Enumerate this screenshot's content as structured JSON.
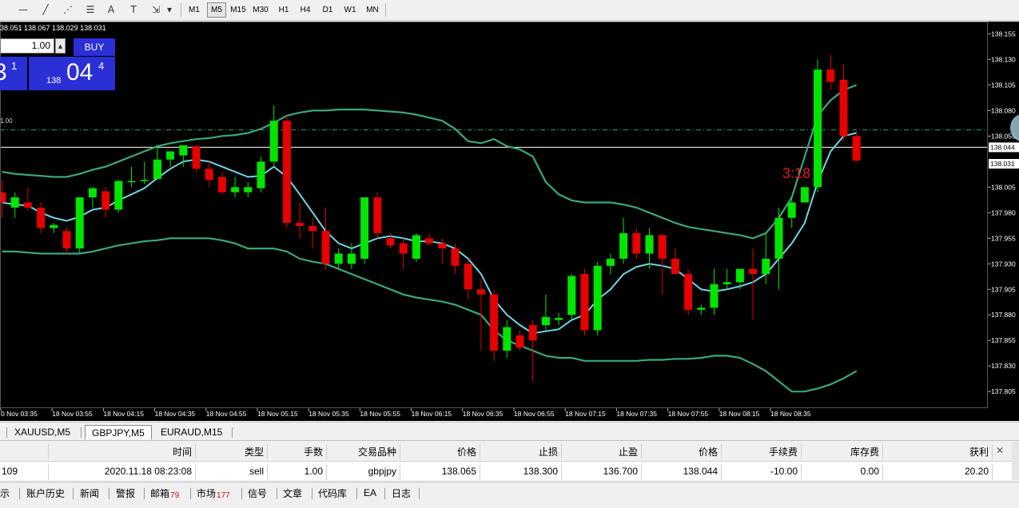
{
  "toolbar": {
    "drawing_tools": [
      {
        "name": "horizontal-line-icon",
        "glyph": "—"
      },
      {
        "name": "trendline-icon",
        "glyph": "╱"
      },
      {
        "name": "fibonacci-fan-icon",
        "glyph": "⋰"
      },
      {
        "name": "fibonacci-retracement-icon",
        "glyph": "☰"
      },
      {
        "name": "text-icon",
        "glyph": "A"
      },
      {
        "name": "text-label-icon",
        "glyph": "T"
      },
      {
        "name": "arrows-icon",
        "glyph": "⇲"
      },
      {
        "name": "chevron-down-icon",
        "glyph": "▾"
      }
    ],
    "timeframes": [
      "M1",
      "M5",
      "M15",
      "M30",
      "H1",
      "H4",
      "D1",
      "W1",
      "MN"
    ],
    "active_timeframe": "M5"
  },
  "chart": {
    "ohlc_text": "38.051 138.067 138.029 138.031",
    "lot_value": "1.00",
    "buy_label": "BUY",
    "sell_price_big": "3",
    "sell_price_sup": "1",
    "buy_price_prefix": "138",
    "buy_price_big": "04",
    "buy_price_sup": "4",
    "lot_line_label": "1.00",
    "countdown": "3:18",
    "price_labels": [
      "138.155",
      "138.130",
      "138.105",
      "138.080",
      "138.055",
      "138.005",
      "137.980",
      "137.955",
      "137.930",
      "137.905",
      "137.880",
      "137.855",
      "137.830",
      "137.805"
    ],
    "current_price_label": "138.044",
    "bid_price_label": "138.031",
    "time_labels": [
      "0 Nov 03:35",
      "18 Nov 03:55",
      "18 Nov 04:15",
      "18 Nov 04:35",
      "18 Nov 04:55",
      "18 Nov 05:15",
      "18 Nov 05:35",
      "18 Nov 05:55",
      "18 Nov 06:15",
      "18 Nov 06:35",
      "18 Nov 06:55",
      "18 Nov 07:15",
      "18 Nov 07:35",
      "18 Nov 07:55",
      "18 Nov 08:15",
      "18 Nov 08:35"
    ],
    "colors": {
      "bull": "#00e600",
      "bear": "#e60000",
      "bands": "#3aa87a",
      "ma": "#6fd7e6",
      "price_line": "#ffffff",
      "lot_line": "#2e9e6e"
    }
  },
  "chart_data": {
    "type": "candlestick",
    "symbol": "GBPJPY",
    "timeframe": "M5",
    "ylim": [
      137.795,
      138.16
    ],
    "current_price": 138.044,
    "lot_line_price": 138.061,
    "candles": [
      {
        "o": 138.0,
        "h": 138.012,
        "l": 137.975,
        "c": 137.99
      },
      {
        "o": 137.985,
        "h": 138.0,
        "l": 137.975,
        "c": 137.995
      },
      {
        "o": 137.99,
        "h": 138.005,
        "l": 137.982,
        "c": 137.985
      },
      {
        "o": 137.985,
        "h": 137.99,
        "l": 137.96,
        "c": 137.965
      },
      {
        "o": 137.965,
        "h": 137.97,
        "l": 137.96,
        "c": 137.968
      },
      {
        "o": 137.962,
        "h": 137.966,
        "l": 137.94,
        "c": 137.945
      },
      {
        "o": 137.945,
        "h": 137.995,
        "l": 137.94,
        "c": 137.995
      },
      {
        "o": 137.995,
        "h": 138.005,
        "l": 137.985,
        "c": 138.004
      },
      {
        "o": 138.001,
        "h": 138.005,
        "l": 137.975,
        "c": 137.983
      },
      {
        "o": 137.983,
        "h": 138.012,
        "l": 137.98,
        "c": 138.011
      },
      {
        "o": 138.011,
        "h": 138.025,
        "l": 138.005,
        "c": 138.011
      },
      {
        "o": 138.012,
        "h": 138.03,
        "l": 138.008,
        "c": 138.012
      },
      {
        "o": 138.013,
        "h": 138.046,
        "l": 138.012,
        "c": 138.032
      },
      {
        "o": 138.032,
        "h": 138.04,
        "l": 138.025,
        "c": 138.04
      },
      {
        "o": 138.036,
        "h": 138.045,
        "l": 138.025,
        "c": 138.046
      },
      {
        "o": 138.045,
        "h": 138.046,
        "l": 138.02,
        "c": 138.023
      },
      {
        "o": 138.023,
        "h": 138.03,
        "l": 138.005,
        "c": 138.012
      },
      {
        "o": 138.015,
        "h": 138.02,
        "l": 137.998,
        "c": 138.0
      },
      {
        "o": 138.0,
        "h": 138.015,
        "l": 137.995,
        "c": 138.005
      },
      {
        "o": 138.0,
        "h": 138.01,
        "l": 137.995,
        "c": 138.005
      },
      {
        "o": 138.004,
        "h": 138.035,
        "l": 138.0,
        "c": 138.03
      },
      {
        "o": 138.03,
        "h": 138.085,
        "l": 138.025,
        "c": 138.07
      },
      {
        "o": 138.07,
        "h": 138.075,
        "l": 137.965,
        "c": 137.97
      },
      {
        "o": 137.97,
        "h": 137.99,
        "l": 137.955,
        "c": 137.967
      },
      {
        "o": 137.967,
        "h": 137.975,
        "l": 137.945,
        "c": 137.962
      },
      {
        "o": 137.962,
        "h": 137.985,
        "l": 137.925,
        "c": 137.93
      },
      {
        "o": 137.93,
        "h": 137.945,
        "l": 137.925,
        "c": 137.94
      },
      {
        "o": 137.93,
        "h": 137.95,
        "l": 137.925,
        "c": 137.94
      },
      {
        "o": 137.935,
        "h": 137.995,
        "l": 137.93,
        "c": 137.995
      },
      {
        "o": 137.995,
        "h": 138.0,
        "l": 137.955,
        "c": 137.96
      },
      {
        "o": 137.955,
        "h": 137.96,
        "l": 137.945,
        "c": 137.948
      },
      {
        "o": 137.95,
        "h": 137.955,
        "l": 137.925,
        "c": 137.94
      },
      {
        "o": 137.935,
        "h": 137.96,
        "l": 137.932,
        "c": 137.958
      },
      {
        "o": 137.955,
        "h": 137.96,
        "l": 137.948,
        "c": 137.95
      },
      {
        "o": 137.95,
        "h": 137.955,
        "l": 137.93,
        "c": 137.945
      },
      {
        "o": 137.945,
        "h": 137.95,
        "l": 137.92,
        "c": 137.928
      },
      {
        "o": 137.93,
        "h": 137.935,
        "l": 137.895,
        "c": 137.905
      },
      {
        "o": 137.905,
        "h": 137.915,
        "l": 137.845,
        "c": 137.9
      },
      {
        "o": 137.9,
        "h": 137.905,
        "l": 137.835,
        "c": 137.845
      },
      {
        "o": 137.845,
        "h": 137.875,
        "l": 137.838,
        "c": 137.868
      },
      {
        "o": 137.86,
        "h": 137.865,
        "l": 137.845,
        "c": 137.848
      },
      {
        "o": 137.87,
        "h": 137.875,
        "l": 137.815,
        "c": 137.855
      },
      {
        "o": 137.87,
        "h": 137.9,
        "l": 137.865,
        "c": 137.878
      },
      {
        "o": 137.875,
        "h": 137.882,
        "l": 137.87,
        "c": 137.877
      },
      {
        "o": 137.88,
        "h": 137.92,
        "l": 137.875,
        "c": 137.918
      },
      {
        "o": 137.92,
        "h": 137.925,
        "l": 137.86,
        "c": 137.865
      },
      {
        "o": 137.865,
        "h": 137.932,
        "l": 137.86,
        "c": 137.928
      },
      {
        "o": 137.928,
        "h": 137.94,
        "l": 137.92,
        "c": 137.935
      },
      {
        "o": 137.935,
        "h": 137.975,
        "l": 137.93,
        "c": 137.96
      },
      {
        "o": 137.96,
        "h": 137.965,
        "l": 137.935,
        "c": 137.94
      },
      {
        "o": 137.94,
        "h": 137.965,
        "l": 137.925,
        "c": 137.958
      },
      {
        "o": 137.958,
        "h": 137.96,
        "l": 137.9,
        "c": 137.935
      },
      {
        "o": 137.935,
        "h": 137.945,
        "l": 137.92,
        "c": 137.92
      },
      {
        "o": 137.92,
        "h": 137.925,
        "l": 137.88,
        "c": 137.885
      },
      {
        "o": 137.885,
        "h": 137.89,
        "l": 137.88,
        "c": 137.887
      },
      {
        "o": 137.887,
        "h": 137.925,
        "l": 137.88,
        "c": 137.91
      },
      {
        "o": 137.91,
        "h": 137.925,
        "l": 137.905,
        "c": 137.912
      },
      {
        "o": 137.912,
        "h": 137.925,
        "l": 137.905,
        "c": 137.925
      },
      {
        "o": 137.925,
        "h": 137.945,
        "l": 137.875,
        "c": 137.92
      },
      {
        "o": 137.92,
        "h": 137.96,
        "l": 137.91,
        "c": 137.935
      },
      {
        "o": 137.935,
        "h": 137.985,
        "l": 137.905,
        "c": 137.975
      },
      {
        "o": 137.975,
        "h": 137.995,
        "l": 137.965,
        "c": 137.99
      },
      {
        "o": 137.99,
        "h": 138.005,
        "l": 137.99,
        "c": 138.005
      },
      {
        "o": 138.005,
        "h": 138.13,
        "l": 138.0,
        "c": 138.12
      },
      {
        "o": 138.12,
        "h": 138.135,
        "l": 138.1,
        "c": 138.108
      },
      {
        "o": 138.11,
        "h": 138.125,
        "l": 138.05,
        "c": 138.055
      },
      {
        "o": 138.055,
        "h": 138.06,
        "l": 138.03,
        "c": 138.031
      }
    ],
    "ma": [
      137.99,
      137.988,
      137.987,
      137.98,
      137.975,
      137.972,
      137.976,
      137.983,
      137.985,
      137.992,
      137.998,
      138.004,
      138.014,
      138.023,
      138.03,
      138.032,
      138.03,
      138.025,
      138.02,
      138.015,
      138.016,
      138.025,
      138.015,
      137.998,
      137.98,
      137.962,
      137.95,
      137.945,
      137.95,
      137.955,
      137.957,
      137.955,
      137.952,
      137.952,
      137.95,
      137.945,
      137.935,
      137.92,
      137.895,
      137.88,
      137.87,
      137.862,
      137.864,
      137.866,
      137.875,
      137.88,
      137.895,
      137.905,
      137.92,
      137.927,
      137.93,
      137.928,
      137.925,
      137.915,
      137.905,
      137.903,
      137.905,
      137.908,
      137.912,
      137.92,
      137.935,
      137.95,
      137.97,
      138.01,
      138.04,
      138.055,
      138.058
    ],
    "upper_band": [
      138.02,
      138.018,
      138.017,
      138.016,
      138.015,
      138.015,
      138.018,
      138.022,
      138.025,
      138.03,
      138.035,
      138.04,
      138.045,
      138.048,
      138.05,
      138.052,
      138.053,
      138.055,
      138.056,
      138.058,
      138.062,
      138.068,
      138.075,
      138.078,
      138.08,
      138.08,
      138.081,
      138.081,
      138.081,
      138.08,
      138.079,
      138.078,
      138.076,
      138.073,
      138.07,
      138.062,
      138.05,
      138.048,
      138.052,
      138.045,
      138.042,
      138.035,
      138.01,
      137.998,
      137.992,
      137.99,
      137.99,
      137.99,
      137.988,
      137.985,
      137.98,
      137.975,
      137.97,
      137.966,
      137.964,
      137.962,
      137.96,
      137.958,
      137.955,
      137.96,
      137.975,
      137.995,
      138.035,
      138.075,
      138.09,
      138.1,
      138.105
    ],
    "lower_band": [
      137.942,
      137.942,
      137.941,
      137.94,
      137.94,
      137.94,
      137.94,
      137.942,
      137.945,
      137.948,
      137.95,
      137.952,
      137.953,
      137.955,
      137.955,
      137.955,
      137.955,
      137.953,
      137.95,
      137.945,
      137.945,
      137.945,
      137.942,
      137.935,
      137.932,
      137.93,
      137.925,
      137.92,
      137.915,
      137.91,
      137.905,
      137.9,
      137.897,
      137.895,
      137.893,
      137.89,
      137.885,
      137.88,
      137.865,
      137.855,
      137.85,
      137.845,
      137.84,
      137.838,
      137.838,
      137.835,
      137.835,
      137.835,
      137.835,
      137.835,
      137.836,
      137.836,
      137.837,
      137.837,
      137.838,
      137.84,
      137.84,
      137.838,
      137.832,
      137.825,
      137.815,
      137.805,
      137.805,
      137.808,
      137.812,
      137.818,
      137.825
    ]
  },
  "tabs": [
    {
      "label": "XAUUSD,M5",
      "active": false
    },
    {
      "label": "GBPJPY,M5",
      "active": true
    },
    {
      "label": "EURAUD,M15",
      "active": false
    }
  ],
  "orders": {
    "headers": {
      "time": "时间",
      "type": "类型",
      "lots": "手数",
      "symbol": "交易品种",
      "price": "价格",
      "sl": "止损",
      "tp": "止盈",
      "price2": "价格",
      "commission": "手续费",
      "swap": "库存费",
      "profit": "获利"
    },
    "row": {
      "ticket": "109",
      "time": "2020.11.18 08:23:08",
      "type": "sell",
      "lots": "1.00",
      "symbol": "gbpjpy",
      "price": "138.065",
      "sl": "138.300",
      "tp": "136.700",
      "price2": "138.044",
      "commission": "-10.00",
      "swap": "0.00",
      "profit": "20.20"
    },
    "close_glyph": "✕"
  },
  "bottom_tabs": [
    {
      "label": "示",
      "badge": ""
    },
    {
      "label": "账户历史",
      "badge": ""
    },
    {
      "label": "新闻",
      "badge": ""
    },
    {
      "label": "警报",
      "badge": ""
    },
    {
      "label": "邮箱",
      "badge": "79"
    },
    {
      "label": "市场",
      "badge": "177"
    },
    {
      "label": "信号",
      "badge": ""
    },
    {
      "label": "文章",
      "badge": ""
    },
    {
      "label": "代码库",
      "badge": ""
    },
    {
      "label": "EA",
      "badge": ""
    },
    {
      "label": "日志",
      "badge": ""
    }
  ]
}
